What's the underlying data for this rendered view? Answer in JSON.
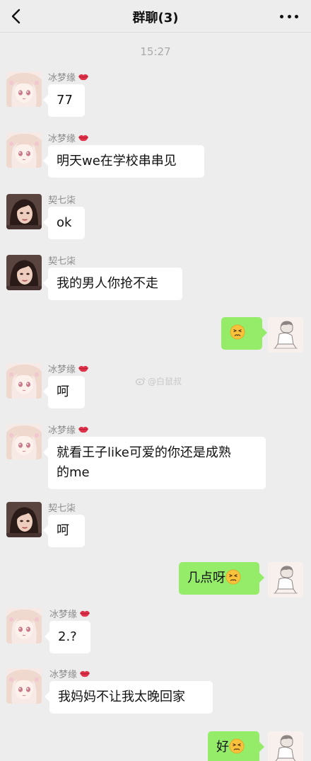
{
  "header": {
    "title": "群聊(3)"
  },
  "timestamp": "15:27",
  "watermark": "@白鼠叔",
  "accent_colors": {
    "self_bubble": "#95ec69",
    "other_bubble": "#ffffff",
    "background": "#ededed"
  },
  "messages": [
    {
      "side": "left",
      "sender": "冰梦缘",
      "has_lips": true,
      "avatar": "anime-girl",
      "lines": [
        "77"
      ]
    },
    {
      "side": "left",
      "sender": "冰梦缘",
      "has_lips": true,
      "avatar": "anime-girl",
      "lines": [
        "明天we在学校串串见"
      ]
    },
    {
      "side": "left",
      "sender": "契七柒",
      "has_lips": false,
      "avatar": "photo-girl",
      "lines": [
        "ok"
      ]
    },
    {
      "side": "left",
      "sender": "契七柒",
      "has_lips": false,
      "avatar": "photo-girl",
      "lines": [
        "我的男人你抢不走"
      ]
    },
    {
      "side": "right",
      "sender": "",
      "has_lips": false,
      "avatar": "sketch-boy",
      "lines": [
        ""
      ],
      "emoji": "persevering-face"
    },
    {
      "side": "left",
      "sender": "冰梦缘",
      "has_lips": true,
      "avatar": "anime-girl",
      "lines": [
        "呵"
      ]
    },
    {
      "side": "left",
      "sender": "冰梦缘",
      "has_lips": true,
      "avatar": "anime-girl",
      "lines": [
        "就看王子like可爱的你还是成熟",
        "的me"
      ]
    },
    {
      "side": "left",
      "sender": "契七柒",
      "has_lips": false,
      "avatar": "photo-girl",
      "lines": [
        "呵"
      ]
    },
    {
      "side": "right",
      "sender": "",
      "has_lips": false,
      "avatar": "sketch-boy",
      "lines": [
        "几点呀"
      ],
      "emoji": "persevering-face"
    },
    {
      "side": "left",
      "sender": "冰梦缘",
      "has_lips": true,
      "avatar": "anime-girl",
      "lines": [
        "2.?"
      ]
    },
    {
      "side": "left",
      "sender": "冰梦缘",
      "has_lips": true,
      "avatar": "anime-girl",
      "lines": [
        "我妈妈不让我太晚回家"
      ]
    },
    {
      "side": "right",
      "sender": "",
      "has_lips": false,
      "avatar": "sketch-boy",
      "lines": [
        "好"
      ],
      "emoji": "persevering-face"
    }
  ]
}
